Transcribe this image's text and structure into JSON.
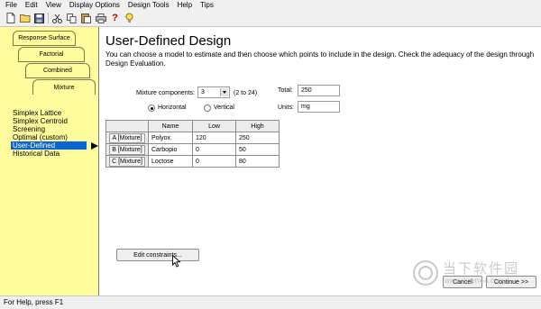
{
  "menubar": {
    "items": [
      "File",
      "Edit",
      "View",
      "Display Options",
      "Design Tools",
      "Help",
      "Tips"
    ]
  },
  "toolbar": {
    "icons": [
      "new-document-icon",
      "open-folder-icon",
      "save-icon",
      "cut-icon",
      "copy-icon",
      "paste-icon",
      "print-icon",
      "help-icon",
      "tip-lightbulb-icon"
    ]
  },
  "left_panel": {
    "tabs": [
      "Response Surface",
      "Factorial",
      "Combined",
      "Mixture"
    ],
    "design_types": [
      "Simplex Lattice",
      "Simplex Centroid",
      "Screening",
      "Optimal (custom)",
      "User-Defined",
      "Historical Data"
    ],
    "selected_design": "User-Defined"
  },
  "main": {
    "title": "User-Defined Design",
    "description": "You can choose a model to estimate and then choose which points to include in the design.  Check the adequacy of the design through Design Evaluation.",
    "mixture_components_label": "Mixture components:",
    "mixture_components_value": "3",
    "mixture_components_range": "(2 to 24)",
    "total_label": "Total:",
    "total_value": "250",
    "units_label": "Units:",
    "units_value": "mg",
    "orientation": {
      "horizontal_label": "Horizontal",
      "vertical_label": "Vertical",
      "selected": "Horizontal"
    },
    "table": {
      "headers": [
        "Name",
        "Low",
        "High"
      ],
      "rows": [
        {
          "component": "A [Mixture]",
          "name": "Polyox",
          "low": "120",
          "high": "250"
        },
        {
          "component": "B [Mixture]",
          "name": "Carbopio",
          "low": "0",
          "high": "50"
        },
        {
          "component": "C [Mixture]",
          "name": "Loctose",
          "low": "0",
          "high": "80"
        }
      ]
    },
    "edit_constraints_label": "Edit constraints...",
    "cancel_label": "Cancel",
    "continue_label": "Continue >>"
  },
  "statusbar": {
    "text": "For Help, press F1"
  },
  "watermark": {
    "text": "当下软件园",
    "url": "www.downxia.com"
  },
  "colors": {
    "panel_yellow": "#fffc9e",
    "selection_blue": "#0a64d2",
    "chrome_gray": "#f0f0f0"
  }
}
